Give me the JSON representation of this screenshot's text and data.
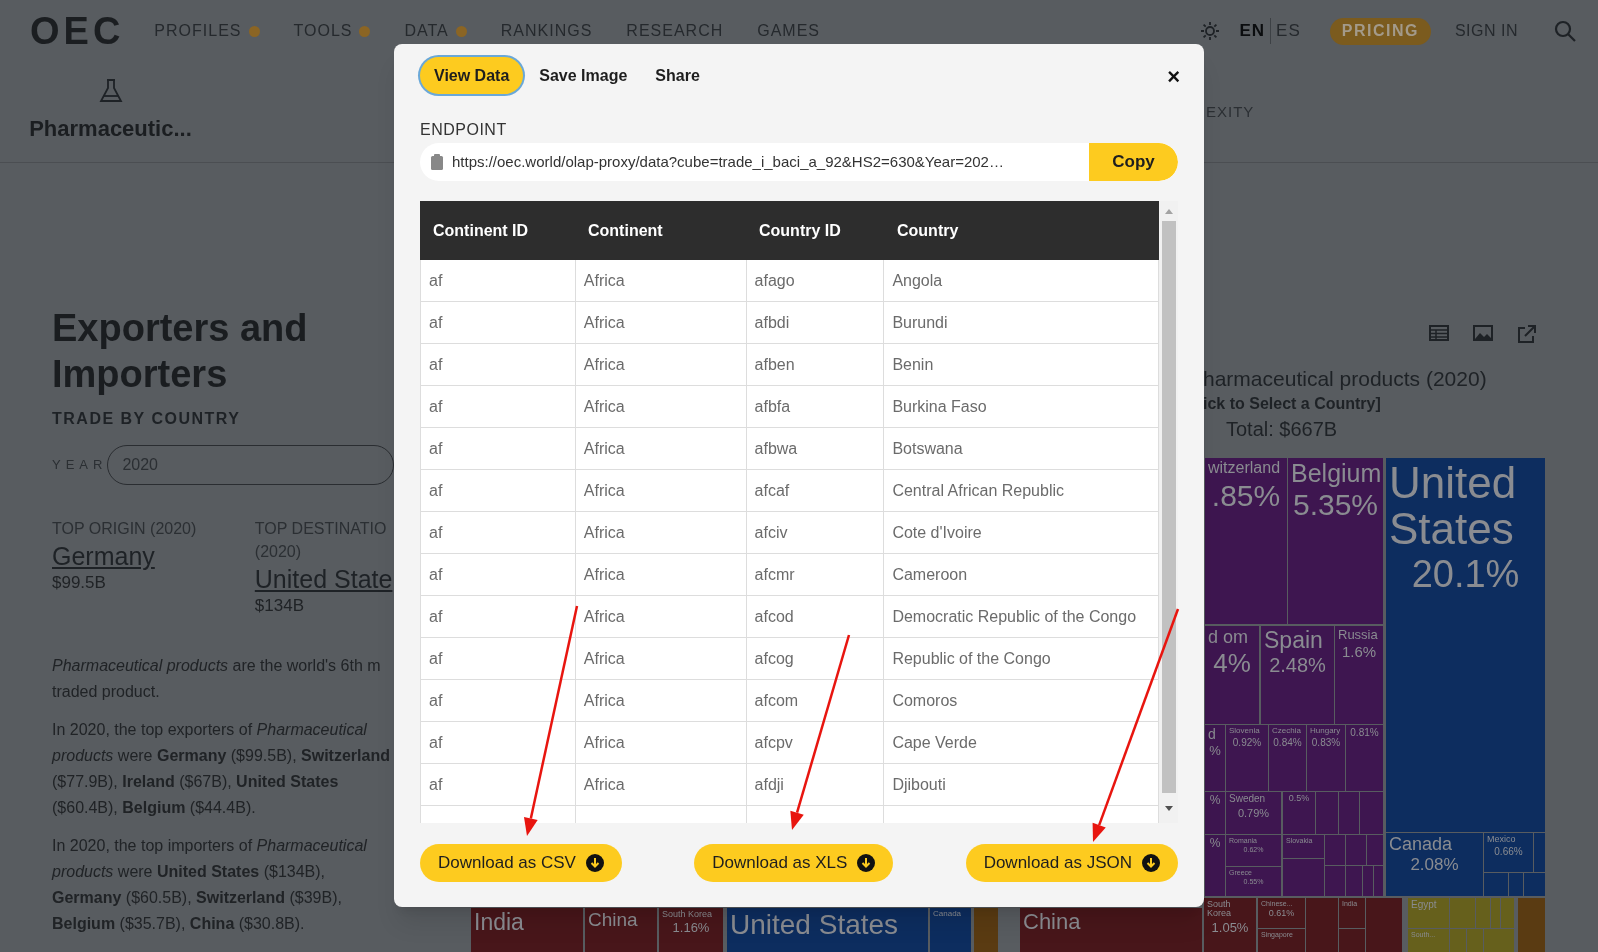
{
  "nav": {
    "logo": "OEC",
    "items": [
      {
        "label": "PROFILES",
        "dot": true
      },
      {
        "label": "TOOLS",
        "dot": true
      },
      {
        "label": "DATA",
        "dot": true
      },
      {
        "label": "RANKINGS",
        "dot": false
      },
      {
        "label": "RESEARCH",
        "dot": false
      },
      {
        "label": "GAMES",
        "dot": false
      }
    ],
    "languages": [
      {
        "label": "EN",
        "selected": true
      },
      {
        "label": "ES",
        "selected": false
      }
    ],
    "pricing": "PRICING",
    "sign_in": "SIGN IN"
  },
  "product": {
    "title": "Pharmaceutic..."
  },
  "section_tab": "EXITY",
  "section": {
    "title": "Exporters and Importers",
    "subtitle": "TRADE BY COUNTRY",
    "year_label": "YEAR",
    "year_value": "2020",
    "top_origin": {
      "label": "TOP ORIGIN (2020)",
      "name": "Germany",
      "value": "$99.5B"
    },
    "top_destination": {
      "label": "TOP DESTINATIO (2020)",
      "name": "United State",
      "value": "$134B"
    },
    "paragraphs": [
      "*Pharmaceutical products* are the world's 6th m traded product.",
      "In 2020, the top exporters of *Pharmaceutical products* were **Germany** ($99.5B), **Switzerland** ($77.9B), **Ireland** ($67B), **United States** ($60.4B), **Belgium** ($44.4B).",
      "In 2020, the top importers of *Pharmaceutical products* were **United States** ($134B), **Germany** ($60.5B), **Switzerland** ($39B), **Belgium** ($35.7B), **China** ($30.8B)."
    ]
  },
  "chart": {
    "title": "harmaceutical products (2020)",
    "subtitle": "ick to Select a Country]",
    "total": "Total: $667B",
    "cells": [
      {
        "label": "witzerland",
        "value": ".85%",
        "color": "#3e1650"
      },
      {
        "label": "Belgium",
        "value": "5.35%",
        "color": "#3e1650"
      },
      {
        "label": "United States",
        "value": "20.1%",
        "color": "#0d2d5f"
      },
      {
        "label": "d om",
        "value": "4%",
        "color": "#3e1650"
      },
      {
        "label": "Spain",
        "value": "2.48%",
        "color": "#3e1650"
      },
      {
        "label": "Russia",
        "value": "1.6%",
        "color": "#3e1650"
      },
      {
        "label": "d",
        "value": "%",
        "color": "#3e1650"
      },
      {
        "label": "Slovenia",
        "value": "0.92%",
        "color": "#3e1650"
      },
      {
        "label": "Czechia",
        "value": "0.84%",
        "color": "#3e1650"
      },
      {
        "label": "Hungary",
        "value": "0.83%",
        "color": "#3e1650"
      },
      {
        "value": "0.81%",
        "color": "#3e1650"
      },
      {
        "value": "%",
        "color": "#3e1650"
      },
      {
        "label": "Sweden",
        "value": "0.79%",
        "color": "#3e1650"
      },
      {
        "value": "0.5%",
        "color": "#3e1650"
      },
      {
        "value": "%",
        "color": "#3e1650"
      },
      {
        "label": "Romania",
        "value": "0.62%",
        "color": "#3e1650"
      },
      {
        "label": "Greece",
        "value": "0.55%",
        "color": "#3e1650"
      },
      {
        "label": "Slovakia",
        "color": "#3e1650"
      },
      {
        "label": "Canada",
        "value": "2.08%",
        "color": "#0d2d5f"
      },
      {
        "label": "Mexico",
        "value": "0.66%",
        "color": "#0d2d5f"
      },
      {
        "label": "India",
        "color": "#48161a"
      },
      {
        "label": "China",
        "color": "#48161a"
      },
      {
        "label": "South Korea",
        "value": "1.16%",
        "color": "#48161a"
      },
      {
        "label": "United States",
        "color": "#0d2d5f"
      },
      {
        "label": "Canada",
        "color": "#0d2d5f"
      },
      {
        "label": "China",
        "color": "#48161a"
      },
      {
        "label": "South Korea",
        "value": "1.05%",
        "color": "#48161a"
      },
      {
        "label": "Chinese...",
        "value": "0.61%",
        "color": "#48161a"
      },
      {
        "label": "Singapore",
        "color": "#48161a"
      },
      {
        "label": "India",
        "color": "#48161a"
      },
      {
        "label": "Egypt",
        "color": "#66601c"
      },
      {
        "label": "South...",
        "color": "#66601c"
      }
    ]
  },
  "modal": {
    "tabs": [
      {
        "label": "View Data",
        "selected": true
      },
      {
        "label": "Save Image",
        "selected": false
      },
      {
        "label": "Share",
        "selected": false
      }
    ],
    "close": "×",
    "endpoint_label": "ENDPOINT",
    "endpoint": "https://oec.world/olap-proxy/data?cube=trade_i_baci_a_92&HS2=630&Year=202…",
    "copy": "Copy",
    "table": {
      "columns": [
        "Continent ID",
        "Continent",
        "Country ID",
        "Country"
      ],
      "rows": [
        [
          "af",
          "Africa",
          "afago",
          "Angola"
        ],
        [
          "af",
          "Africa",
          "afbdi",
          "Burundi"
        ],
        [
          "af",
          "Africa",
          "afben",
          "Benin"
        ],
        [
          "af",
          "Africa",
          "afbfa",
          "Burkina Faso"
        ],
        [
          "af",
          "Africa",
          "afbwa",
          "Botswana"
        ],
        [
          "af",
          "Africa",
          "afcaf",
          "Central African Republic"
        ],
        [
          "af",
          "Africa",
          "afciv",
          "Cote d'Ivoire"
        ],
        [
          "af",
          "Africa",
          "afcmr",
          "Cameroon"
        ],
        [
          "af",
          "Africa",
          "afcod",
          "Democratic Republic of the Congo"
        ],
        [
          "af",
          "Africa",
          "afcog",
          "Republic of the Congo"
        ],
        [
          "af",
          "Africa",
          "afcom",
          "Comoros"
        ],
        [
          "af",
          "Africa",
          "afcpv",
          "Cape Verde"
        ],
        [
          "af",
          "Africa",
          "afdji",
          "Djibouti"
        ]
      ]
    },
    "downloads": [
      "Download as CSV",
      "Download as XLS",
      "Download as JSON"
    ]
  }
}
